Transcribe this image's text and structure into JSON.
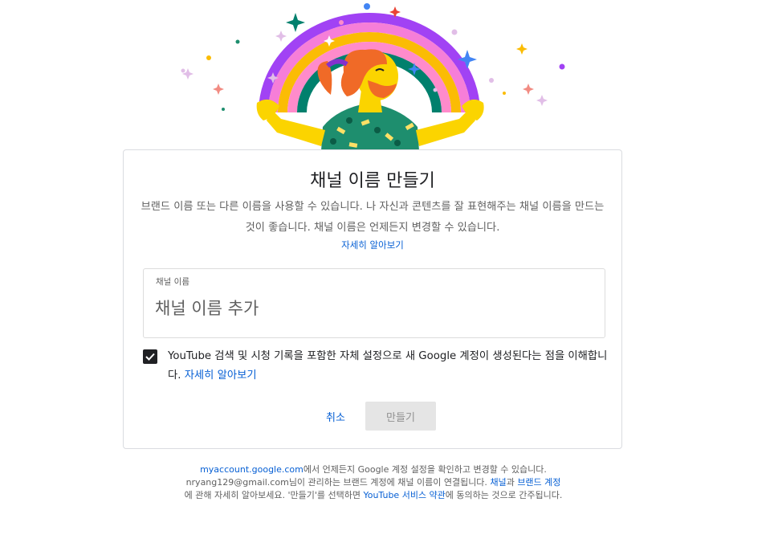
{
  "dialog": {
    "title": "채널 이름 만들기",
    "description": "브랜드 이름 또는 다른 이름을 사용할 수 있습니다. 나 자신과 콘텐츠를 잘 표현해주는 채널 이름을 만드는 것이 좋습니다. 채널 이름은 언제든지 변경할 수 있습니다.",
    "learn_more": "자세히 알아보기",
    "name_field": {
      "label": "채널 이름",
      "placeholder": "채널 이름 추가",
      "value": ""
    },
    "consent": {
      "checked": true,
      "text": "YouTube 검색 및 시청 기록을 포함한 자체 설정으로 새 Google 계정이 생성된다는 점을 이해합니다. ",
      "link": "자세히 알아보기"
    },
    "cancel_label": "취소",
    "create_label": "만들기"
  },
  "footer": {
    "line1_link": "myaccount.google.com",
    "line1_text": "에서 언제든지 Google 계정 설정을 확인하고 변경할 수 있습니다.",
    "line2_email": "nryang129@gmail.com",
    "line2_text": "님이 관리하는 브랜드 계정에 채널 이름이 연결됩니다. ",
    "channel_link": "채널",
    "and_text": "과 ",
    "brand_account_link": "브랜드 계정",
    "line3_text": "에 관해 자세히 알아보세요. '만들기'를 선택하면 ",
    "terms_link": "YouTube 서비스 약관",
    "line3_end": "에 동의하는 것으로 간주됩니다."
  },
  "colors": {
    "link": "#065fd4",
    "checkbox": "#202124",
    "disabled_button_bg": "#e5e5e5",
    "disabled_button_text": "#909090"
  }
}
